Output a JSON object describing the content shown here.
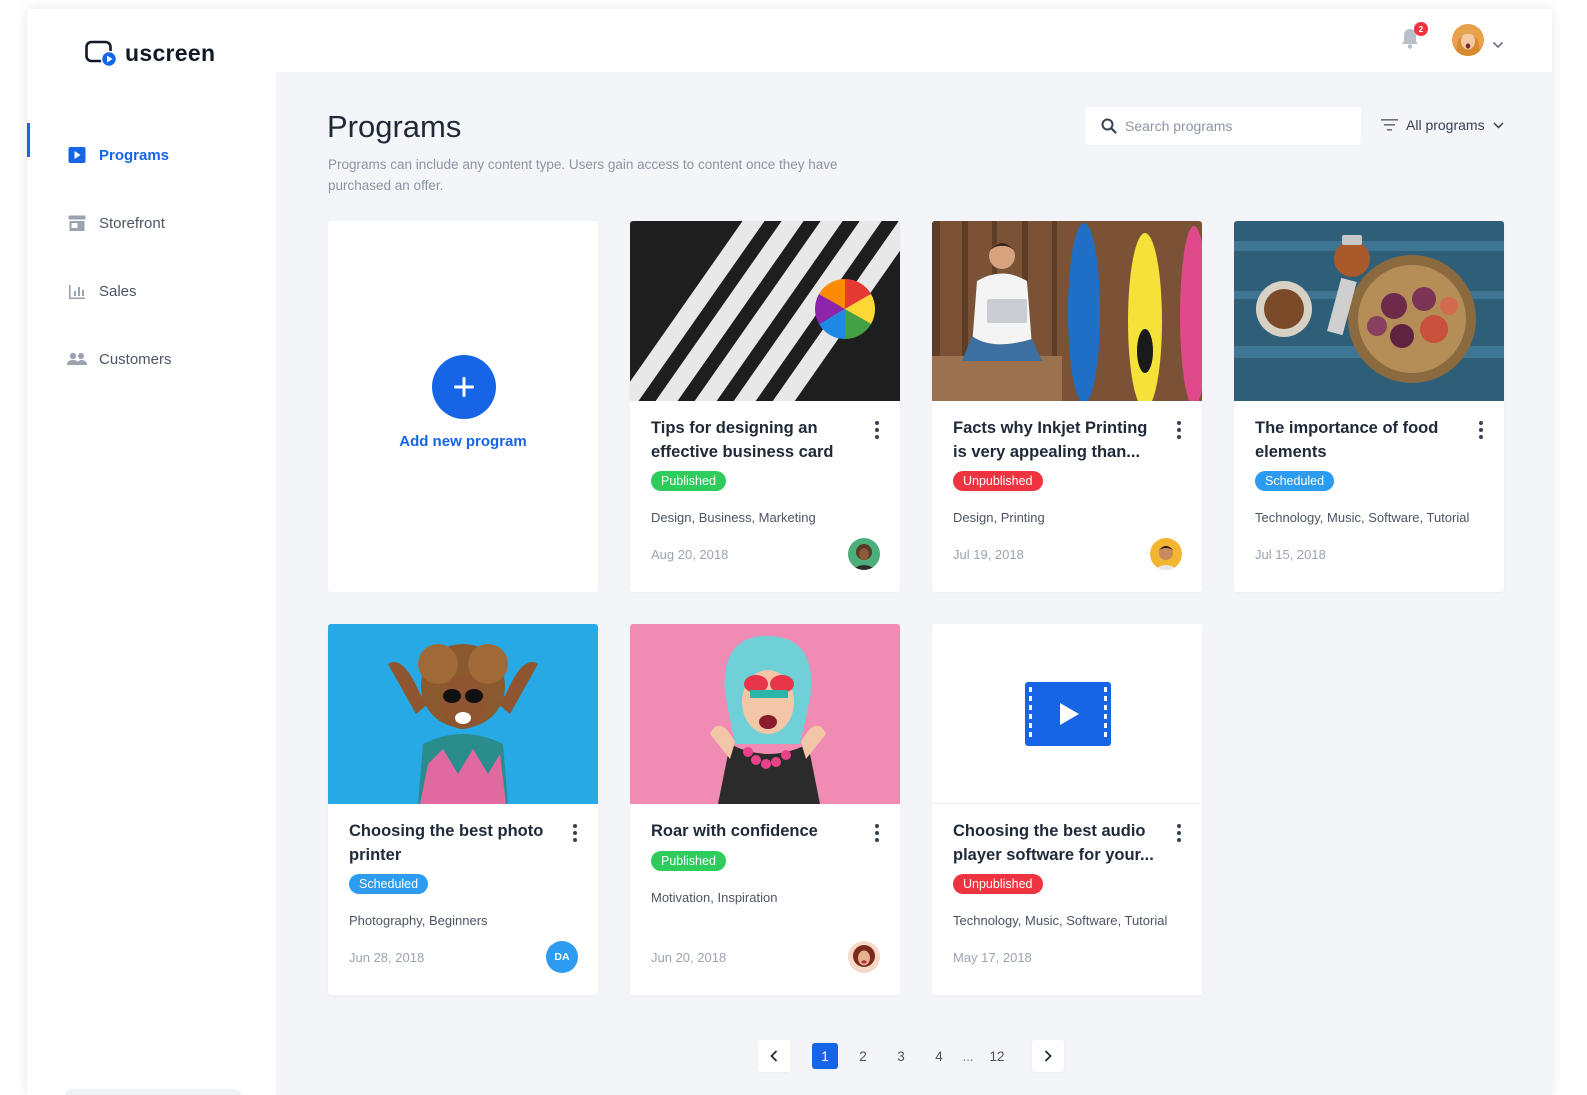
{
  "brand": {
    "name": "uscreen"
  },
  "sidebar": {
    "items": [
      {
        "label": "Programs",
        "icon": "play-square-icon",
        "active": true
      },
      {
        "label": "Storefront",
        "icon": "store-icon",
        "active": false
      },
      {
        "label": "Sales",
        "icon": "bar-chart-icon",
        "active": false
      },
      {
        "label": "Customers",
        "icon": "people-icon",
        "active": false
      }
    ]
  },
  "topbar": {
    "notifications_count": "2"
  },
  "header": {
    "title": "Programs",
    "description": "Programs can include any content type. Users gain access to content once they have purchased an offer."
  },
  "search": {
    "placeholder": "Search programs"
  },
  "filter": {
    "label": "All programs"
  },
  "add_program": {
    "label": "Add new program"
  },
  "programs": [
    {
      "title": "Tips for designing an effective business card",
      "status": "Published",
      "tags": "Design, Business, Marketing",
      "date": "Aug 20, 2018",
      "author": ""
    },
    {
      "title": "Facts why Inkjet Printing is very appealing than...",
      "status": "Unpublished",
      "tags": "Design, Printing",
      "date": "Jul 19, 2018",
      "author": ""
    },
    {
      "title": "The importance of food elements",
      "status": "Scheduled",
      "tags": "Technology, Music, Software, Tutorial",
      "date": "Jul 15, 2018",
      "author": ""
    },
    {
      "title": "Choosing the best photo printer",
      "status": "Scheduled",
      "tags": "Photography, Beginners",
      "date": "Jun 28, 2018",
      "author": "DA"
    },
    {
      "title": "Roar with confidence",
      "status": "Published",
      "tags": "Motivation, Inspiration",
      "date": "Jun 20, 2018",
      "author": ""
    },
    {
      "title": "Choosing the best audio player software for your...",
      "status": "Unpublished",
      "tags": "Technology, Music, Software, Tutorial",
      "date": "May 17, 2018",
      "author": ""
    }
  ],
  "pagination": {
    "pages": [
      "1",
      "2",
      "3",
      "4"
    ],
    "ellipsis": "...",
    "last": "12",
    "current": "1"
  },
  "colors": {
    "accent": "#1565e6",
    "published": "#2ecc5c",
    "unpublished": "#ef3340",
    "scheduled": "#2d9cf0",
    "background": "#f4f5f8"
  }
}
